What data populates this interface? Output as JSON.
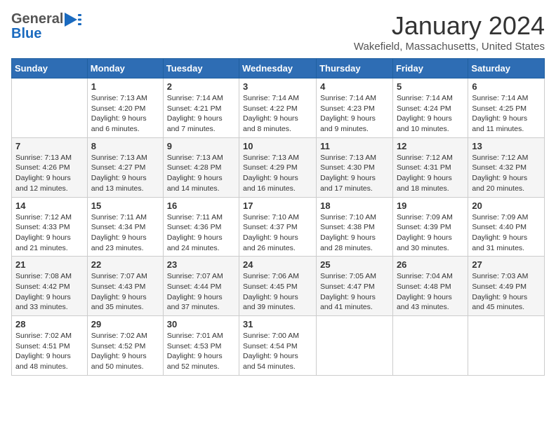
{
  "header": {
    "logo_general": "General",
    "logo_blue": "Blue",
    "month_title": "January 2024",
    "location": "Wakefield, Massachusetts, United States"
  },
  "calendar": {
    "days_of_week": [
      "Sunday",
      "Monday",
      "Tuesday",
      "Wednesday",
      "Thursday",
      "Friday",
      "Saturday"
    ],
    "weeks": [
      [
        {
          "day": "",
          "sunrise": "",
          "sunset": "",
          "daylight": ""
        },
        {
          "day": "1",
          "sunrise": "Sunrise: 7:13 AM",
          "sunset": "Sunset: 4:20 PM",
          "daylight": "Daylight: 9 hours and 6 minutes."
        },
        {
          "day": "2",
          "sunrise": "Sunrise: 7:14 AM",
          "sunset": "Sunset: 4:21 PM",
          "daylight": "Daylight: 9 hours and 7 minutes."
        },
        {
          "day": "3",
          "sunrise": "Sunrise: 7:14 AM",
          "sunset": "Sunset: 4:22 PM",
          "daylight": "Daylight: 9 hours and 8 minutes."
        },
        {
          "day": "4",
          "sunrise": "Sunrise: 7:14 AM",
          "sunset": "Sunset: 4:23 PM",
          "daylight": "Daylight: 9 hours and 9 minutes."
        },
        {
          "day": "5",
          "sunrise": "Sunrise: 7:14 AM",
          "sunset": "Sunset: 4:24 PM",
          "daylight": "Daylight: 9 hours and 10 minutes."
        },
        {
          "day": "6",
          "sunrise": "Sunrise: 7:14 AM",
          "sunset": "Sunset: 4:25 PM",
          "daylight": "Daylight: 9 hours and 11 minutes."
        }
      ],
      [
        {
          "day": "7",
          "sunrise": "Sunrise: 7:13 AM",
          "sunset": "Sunset: 4:26 PM",
          "daylight": "Daylight: 9 hours and 12 minutes."
        },
        {
          "day": "8",
          "sunrise": "Sunrise: 7:13 AM",
          "sunset": "Sunset: 4:27 PM",
          "daylight": "Daylight: 9 hours and 13 minutes."
        },
        {
          "day": "9",
          "sunrise": "Sunrise: 7:13 AM",
          "sunset": "Sunset: 4:28 PM",
          "daylight": "Daylight: 9 hours and 14 minutes."
        },
        {
          "day": "10",
          "sunrise": "Sunrise: 7:13 AM",
          "sunset": "Sunset: 4:29 PM",
          "daylight": "Daylight: 9 hours and 16 minutes."
        },
        {
          "day": "11",
          "sunrise": "Sunrise: 7:13 AM",
          "sunset": "Sunset: 4:30 PM",
          "daylight": "Daylight: 9 hours and 17 minutes."
        },
        {
          "day": "12",
          "sunrise": "Sunrise: 7:12 AM",
          "sunset": "Sunset: 4:31 PM",
          "daylight": "Daylight: 9 hours and 18 minutes."
        },
        {
          "day": "13",
          "sunrise": "Sunrise: 7:12 AM",
          "sunset": "Sunset: 4:32 PM",
          "daylight": "Daylight: 9 hours and 20 minutes."
        }
      ],
      [
        {
          "day": "14",
          "sunrise": "Sunrise: 7:12 AM",
          "sunset": "Sunset: 4:33 PM",
          "daylight": "Daylight: 9 hours and 21 minutes."
        },
        {
          "day": "15",
          "sunrise": "Sunrise: 7:11 AM",
          "sunset": "Sunset: 4:34 PM",
          "daylight": "Daylight: 9 hours and 23 minutes."
        },
        {
          "day": "16",
          "sunrise": "Sunrise: 7:11 AM",
          "sunset": "Sunset: 4:36 PM",
          "daylight": "Daylight: 9 hours and 24 minutes."
        },
        {
          "day": "17",
          "sunrise": "Sunrise: 7:10 AM",
          "sunset": "Sunset: 4:37 PM",
          "daylight": "Daylight: 9 hours and 26 minutes."
        },
        {
          "day": "18",
          "sunrise": "Sunrise: 7:10 AM",
          "sunset": "Sunset: 4:38 PM",
          "daylight": "Daylight: 9 hours and 28 minutes."
        },
        {
          "day": "19",
          "sunrise": "Sunrise: 7:09 AM",
          "sunset": "Sunset: 4:39 PM",
          "daylight": "Daylight: 9 hours and 30 minutes."
        },
        {
          "day": "20",
          "sunrise": "Sunrise: 7:09 AM",
          "sunset": "Sunset: 4:40 PM",
          "daylight": "Daylight: 9 hours and 31 minutes."
        }
      ],
      [
        {
          "day": "21",
          "sunrise": "Sunrise: 7:08 AM",
          "sunset": "Sunset: 4:42 PM",
          "daylight": "Daylight: 9 hours and 33 minutes."
        },
        {
          "day": "22",
          "sunrise": "Sunrise: 7:07 AM",
          "sunset": "Sunset: 4:43 PM",
          "daylight": "Daylight: 9 hours and 35 minutes."
        },
        {
          "day": "23",
          "sunrise": "Sunrise: 7:07 AM",
          "sunset": "Sunset: 4:44 PM",
          "daylight": "Daylight: 9 hours and 37 minutes."
        },
        {
          "day": "24",
          "sunrise": "Sunrise: 7:06 AM",
          "sunset": "Sunset: 4:45 PM",
          "daylight": "Daylight: 9 hours and 39 minutes."
        },
        {
          "day": "25",
          "sunrise": "Sunrise: 7:05 AM",
          "sunset": "Sunset: 4:47 PM",
          "daylight": "Daylight: 9 hours and 41 minutes."
        },
        {
          "day": "26",
          "sunrise": "Sunrise: 7:04 AM",
          "sunset": "Sunset: 4:48 PM",
          "daylight": "Daylight: 9 hours and 43 minutes."
        },
        {
          "day": "27",
          "sunrise": "Sunrise: 7:03 AM",
          "sunset": "Sunset: 4:49 PM",
          "daylight": "Daylight: 9 hours and 45 minutes."
        }
      ],
      [
        {
          "day": "28",
          "sunrise": "Sunrise: 7:02 AM",
          "sunset": "Sunset: 4:51 PM",
          "daylight": "Daylight: 9 hours and 48 minutes."
        },
        {
          "day": "29",
          "sunrise": "Sunrise: 7:02 AM",
          "sunset": "Sunset: 4:52 PM",
          "daylight": "Daylight: 9 hours and 50 minutes."
        },
        {
          "day": "30",
          "sunrise": "Sunrise: 7:01 AM",
          "sunset": "Sunset: 4:53 PM",
          "daylight": "Daylight: 9 hours and 52 minutes."
        },
        {
          "day": "31",
          "sunrise": "Sunrise: 7:00 AM",
          "sunset": "Sunset: 4:54 PM",
          "daylight": "Daylight: 9 hours and 54 minutes."
        },
        {
          "day": "",
          "sunrise": "",
          "sunset": "",
          "daylight": ""
        },
        {
          "day": "",
          "sunrise": "",
          "sunset": "",
          "daylight": ""
        },
        {
          "day": "",
          "sunrise": "",
          "sunset": "",
          "daylight": ""
        }
      ]
    ]
  }
}
